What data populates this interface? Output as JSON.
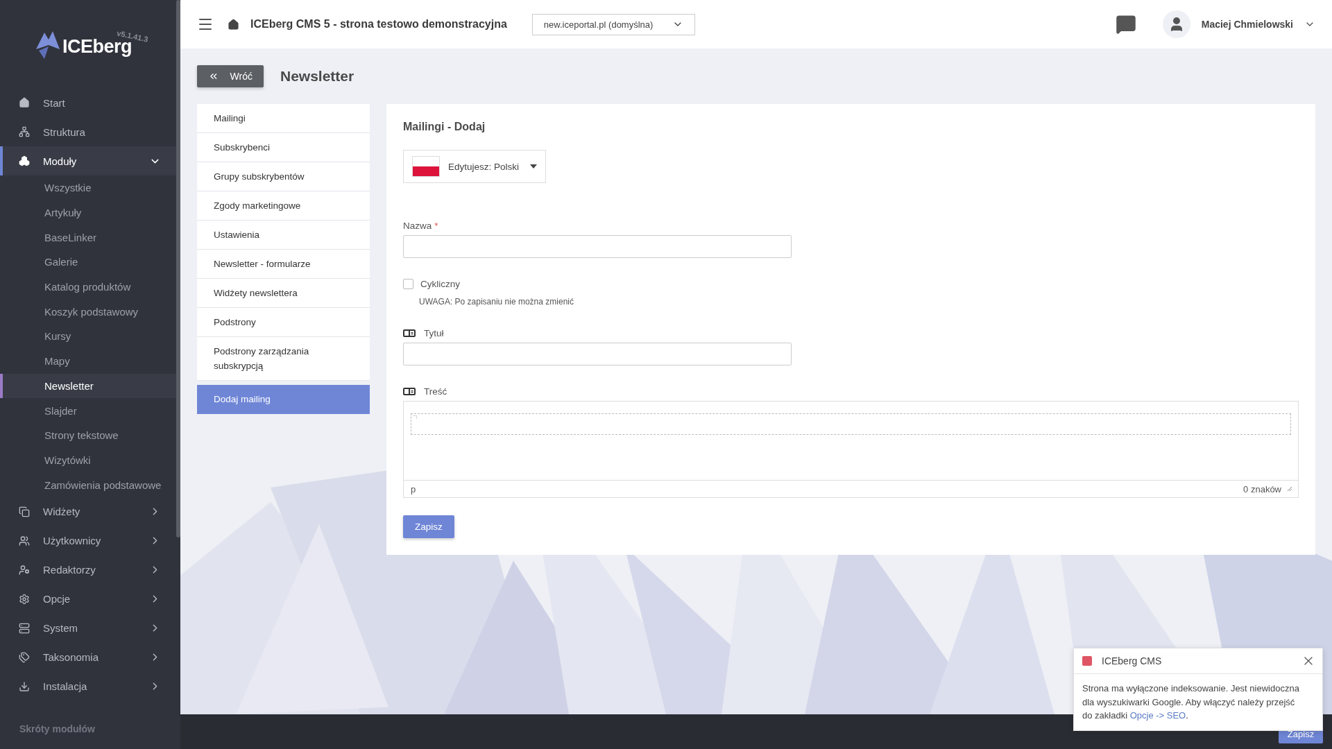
{
  "sidebar": {
    "logo": {
      "text": "ICEberg",
      "version": "v5.1.41.3"
    },
    "items": [
      {
        "kind": "link",
        "label": "Start",
        "selected": false
      },
      {
        "kind": "link",
        "label": "Struktura",
        "selected": false
      },
      {
        "kind": "group",
        "label": "Moduły",
        "selected": true,
        "expanded": true,
        "children": [
          {
            "label": "Wszystkie",
            "selected": false
          },
          {
            "label": "Artykuły",
            "selected": false
          },
          {
            "label": "BaseLinker",
            "selected": false
          },
          {
            "label": "Galerie",
            "selected": false
          },
          {
            "label": "Katalog produktów",
            "selected": false
          },
          {
            "label": "Koszyk podstawowy",
            "selected": false
          },
          {
            "label": "Kursy",
            "selected": false
          },
          {
            "label": "Mapy",
            "selected": false
          },
          {
            "label": "Newsletter",
            "selected": true
          },
          {
            "label": "Slajder",
            "selected": false
          },
          {
            "label": "Strony tekstowe",
            "selected": false
          },
          {
            "label": "Wizytówki",
            "selected": false
          },
          {
            "label": "Zamówienia podstawowe",
            "selected": false
          }
        ]
      },
      {
        "kind": "group",
        "label": "Widżety",
        "selected": false,
        "expanded": false
      },
      {
        "kind": "group",
        "label": "Użytkownicy",
        "selected": false,
        "expanded": false
      },
      {
        "kind": "group",
        "label": "Redaktorzy",
        "selected": false,
        "expanded": false
      },
      {
        "kind": "group",
        "label": "Opcje",
        "selected": false,
        "expanded": false
      },
      {
        "kind": "group",
        "label": "System",
        "selected": false,
        "expanded": false
      },
      {
        "kind": "group",
        "label": "Taksonomia",
        "selected": false,
        "expanded": false
      },
      {
        "kind": "group",
        "label": "Instalacja",
        "selected": false,
        "expanded": false
      }
    ],
    "section_title": "Skróty modułów"
  },
  "topbar": {
    "site_title": "ICEberg CMS 5 - strona testowo demonstracyjna",
    "domain_select": "new.iceportal.pl (domyślna)",
    "user_name": "Maciej Chmielowski"
  },
  "page": {
    "back_button": "Wróć",
    "title": "Newsletter"
  },
  "submenu": {
    "items": [
      {
        "label": "Mailingi",
        "selected": false
      },
      {
        "label": "Subskrybenci",
        "selected": false
      },
      {
        "label": "Grupy subskrybentów",
        "selected": false
      },
      {
        "label": "Zgody marketingowe",
        "selected": false
      },
      {
        "label": "Ustawienia",
        "selected": false
      },
      {
        "label": "Newsletter - formularze",
        "selected": false
      },
      {
        "label": "Widżety newslettera",
        "selected": false
      },
      {
        "label": "Podstrony",
        "selected": false
      },
      {
        "label": "Podstrony zarządzania subskrypcją",
        "selected": false
      },
      {
        "label": "Dodaj mailing",
        "selected": true
      }
    ]
  },
  "form": {
    "title": "Mailingi - Dodaj",
    "language_select": "Edytujesz: Polski",
    "fields": [
      {
        "kind": "text",
        "label": "Nazwa",
        "required_mark": "*"
      },
      {
        "kind": "checkbox",
        "label": "Cykliczny",
        "checked": false,
        "note": "UWAGA: Po zapisaniu nie można zmienić"
      },
      {
        "kind": "translatable",
        "label": "Tytuł"
      },
      {
        "kind": "editor",
        "label": "Treść",
        "path": "p",
        "counter": "0 znaków"
      }
    ],
    "save_button": "Zapisz"
  },
  "bottom_bar": {
    "save_button": "Zapisz"
  },
  "toast": {
    "title": "ICEberg CMS",
    "text": "Strona ma wyłączone indeksowanie. Jest niewidoczna dla wyszukiwarki Google. Aby włączyć należy przejść do zakładki ",
    "link": "Opcje -> SEO",
    "after": "."
  }
}
